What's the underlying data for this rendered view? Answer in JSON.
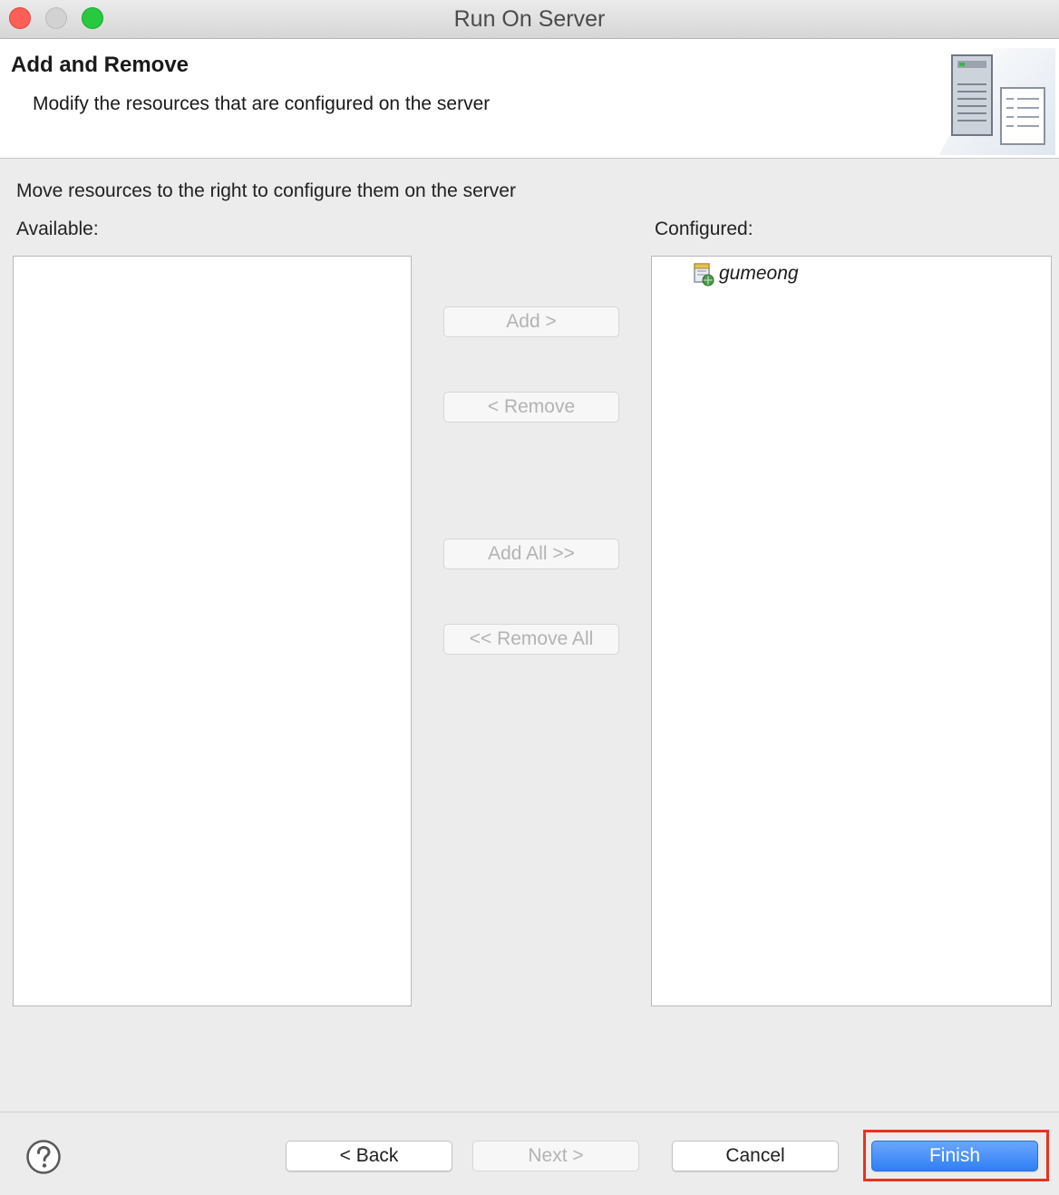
{
  "window": {
    "title": "Run On Server"
  },
  "banner": {
    "title": "Add and Remove",
    "description": "Modify the resources that are configured on the server",
    "icon": "server-wizard-icon"
  },
  "instruction": "Move resources to the right to configure them on the server",
  "available": {
    "label": "Available:",
    "items": []
  },
  "configured": {
    "label": "Configured:",
    "items": [
      {
        "label": "gumeong",
        "icon": "web-project-icon"
      }
    ]
  },
  "transfer_buttons": {
    "add": "Add >",
    "remove": "< Remove",
    "add_all": "Add All >>",
    "remove_all": "<< Remove All"
  },
  "footer": {
    "back": "< Back",
    "next": "Next >",
    "cancel": "Cancel",
    "finish": "Finish",
    "help_icon": "help-icon"
  },
  "colors": {
    "finish_button": "#3b86f7",
    "highlight_box": "#e8321f",
    "traffic_red": "#fe5f57",
    "traffic_green": "#28c840"
  }
}
